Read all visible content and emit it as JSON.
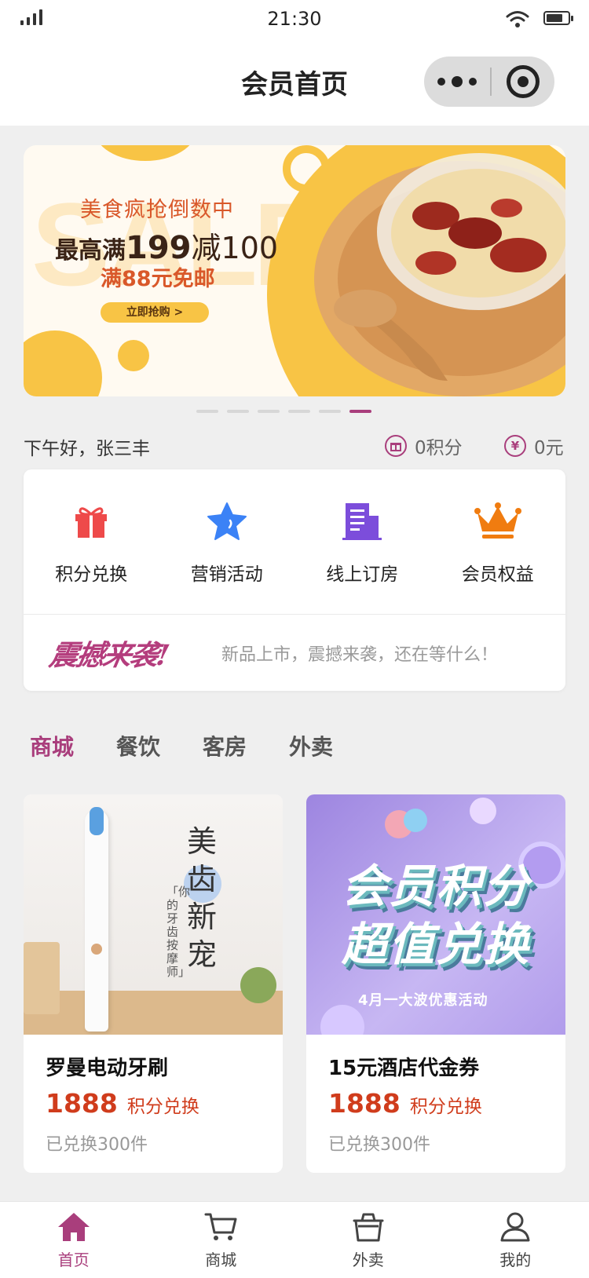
{
  "status_bar": {
    "time": "21:30"
  },
  "header": {
    "title": "会员首页"
  },
  "banner": {
    "watermark": "SALE",
    "headline": "美食疯抢倒数中",
    "offer_prefix": "最高满",
    "offer_threshold": "199",
    "offer_reduce_word": "减",
    "offer_reduce_value": "100",
    "shipping": "满88元免邮",
    "button_label": "立即抢购 >",
    "slide_count": 6,
    "active_slide": 6
  },
  "greeting": {
    "text": "下午好，张三丰",
    "points_icon": "gift-circle-icon",
    "points_label": "0积分",
    "money_icon": "yen-circle-icon",
    "money_glyph": "¥",
    "money_label": "0元"
  },
  "quick_menu": [
    {
      "label": "积分兑换",
      "icon": "gift-icon",
      "color": "#ee4a4a"
    },
    {
      "label": "营销活动",
      "icon": "star-icon",
      "color": "#3b82f6"
    },
    {
      "label": "线上订房",
      "icon": "building-icon",
      "color": "#7c4ddb"
    },
    {
      "label": "会员权益",
      "icon": "crown-icon",
      "color": "#f07c10"
    }
  ],
  "promo": {
    "logo": "震撼来袭!",
    "text": "新品上市，震撼来袭，还在等什么！"
  },
  "category_tabs": [
    {
      "label": "商城",
      "active": true
    },
    {
      "label": "餐饮",
      "active": false
    },
    {
      "label": "客房",
      "active": false
    },
    {
      "label": "外卖",
      "active": false
    }
  ],
  "products": [
    {
      "name": "罗曼电动牙刷",
      "price": "1888",
      "price_unit": "积分兑换",
      "sold": "已兑换300件",
      "image": {
        "title_chars": [
          "美",
          "齿",
          "新",
          "宠"
        ],
        "subtitle": "「你的牙齿按摩师」"
      }
    },
    {
      "name": "15元酒店代金券",
      "price": "1888",
      "price_unit": "积分兑换",
      "sold": "已兑换300件",
      "image": {
        "line1": "会员积分",
        "line2": "超值兑换",
        "ribbon": "4月一大波优惠活动"
      }
    }
  ],
  "tabbar": [
    {
      "label": "首页",
      "icon": "home-icon",
      "active": true
    },
    {
      "label": "商城",
      "icon": "cart-icon",
      "active": false
    },
    {
      "label": "外卖",
      "icon": "bag-icon",
      "active": false
    },
    {
      "label": "我的",
      "icon": "user-icon",
      "active": false
    }
  ],
  "colors": {
    "accent": "#a93e7c",
    "price": "#d03c1c",
    "banner_yellow": "#f8c445"
  }
}
